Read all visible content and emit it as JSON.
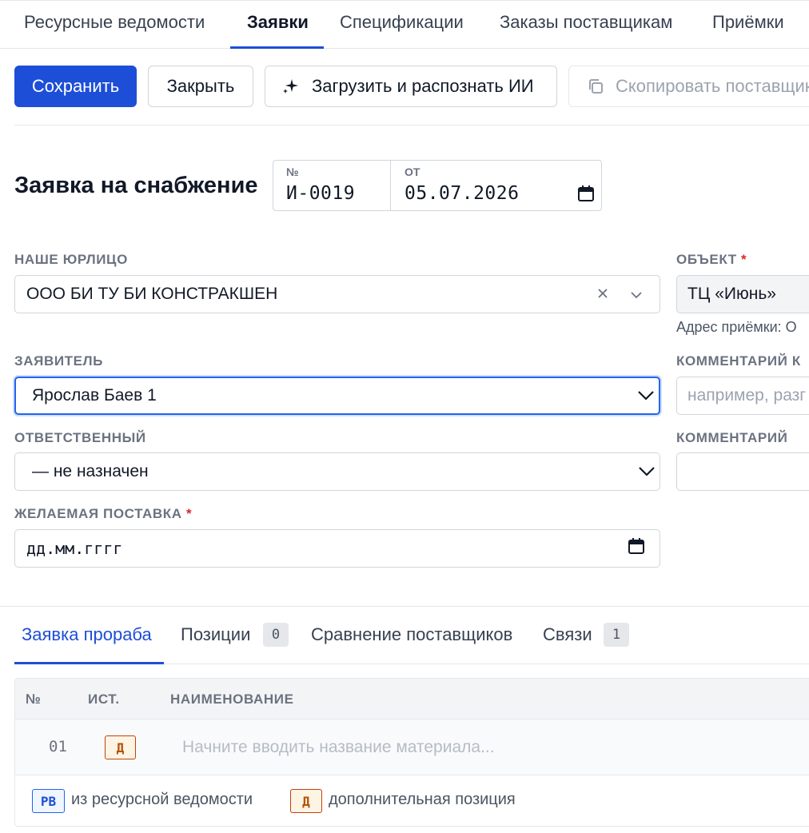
{
  "nav": {
    "tabs": [
      "Ресурсные ведомости",
      "Заявки",
      "Спецификации",
      "Заказы поставщикам",
      "Приёмки"
    ],
    "active": "Заявки"
  },
  "toolbar": {
    "save": "Сохранить",
    "close": "Закрыть",
    "ai_upload": "Загрузить и распознать ИИ",
    "copy_suppliers": "Скопировать поставщиков"
  },
  "doc": {
    "title": "Заявка на снабжение",
    "number_label": "№",
    "number": "И-0019",
    "date_label": "ОТ",
    "date": "05.07.2026"
  },
  "form": {
    "legal_entity": {
      "label": "НАШЕ ЮРЛИЦО",
      "value": "ООО БИ ТУ БИ КОНСТРАКШЕН"
    },
    "applicant": {
      "label": "ЗАЯВИТЕЛЬ",
      "value": "Ярослав Баев 1"
    },
    "responsible": {
      "label": "ОТВЕТСТВЕННЫЙ",
      "value": "— не назначен"
    },
    "desired_delivery": {
      "label": "ЖЕЛАЕМАЯ ПОСТАВКА",
      "required_mark": "*",
      "placeholder": "дд.мм.гггг"
    },
    "object": {
      "label": "ОБЪЕКТ",
      "required_mark": "*",
      "value": "ТЦ «Июнь»",
      "address_hint": "Адрес приёмки: О"
    },
    "comment_top": {
      "label": "КОММЕНТАРИЙ К",
      "placeholder": "например, разг"
    },
    "comment": {
      "label": "КОММЕНТАРИЙ"
    }
  },
  "subtabs": {
    "foreman": "Заявка прораба",
    "positions": "Позиции",
    "positions_count": "0",
    "compare": "Сравнение поставщиков",
    "links": "Связи",
    "links_count": "1"
  },
  "table": {
    "headers": {
      "num": "№",
      "src": "ИСТ.",
      "name": "НАИМЕНОВАНИЕ"
    },
    "rows": [
      {
        "num": "01",
        "src": "Д",
        "name_placeholder": "Начните вводить название материала..."
      }
    ]
  },
  "legend": {
    "rv_tag": "РВ",
    "rv_text": "из ресурсной ведомости",
    "d_tag": "Д",
    "d_text": "дополнительная позиция"
  },
  "colors": {
    "accent": "#1d4ed8",
    "required": "#dc2626",
    "tag_d_border": "#c2410c",
    "tag_rv_border": "#2563eb"
  }
}
